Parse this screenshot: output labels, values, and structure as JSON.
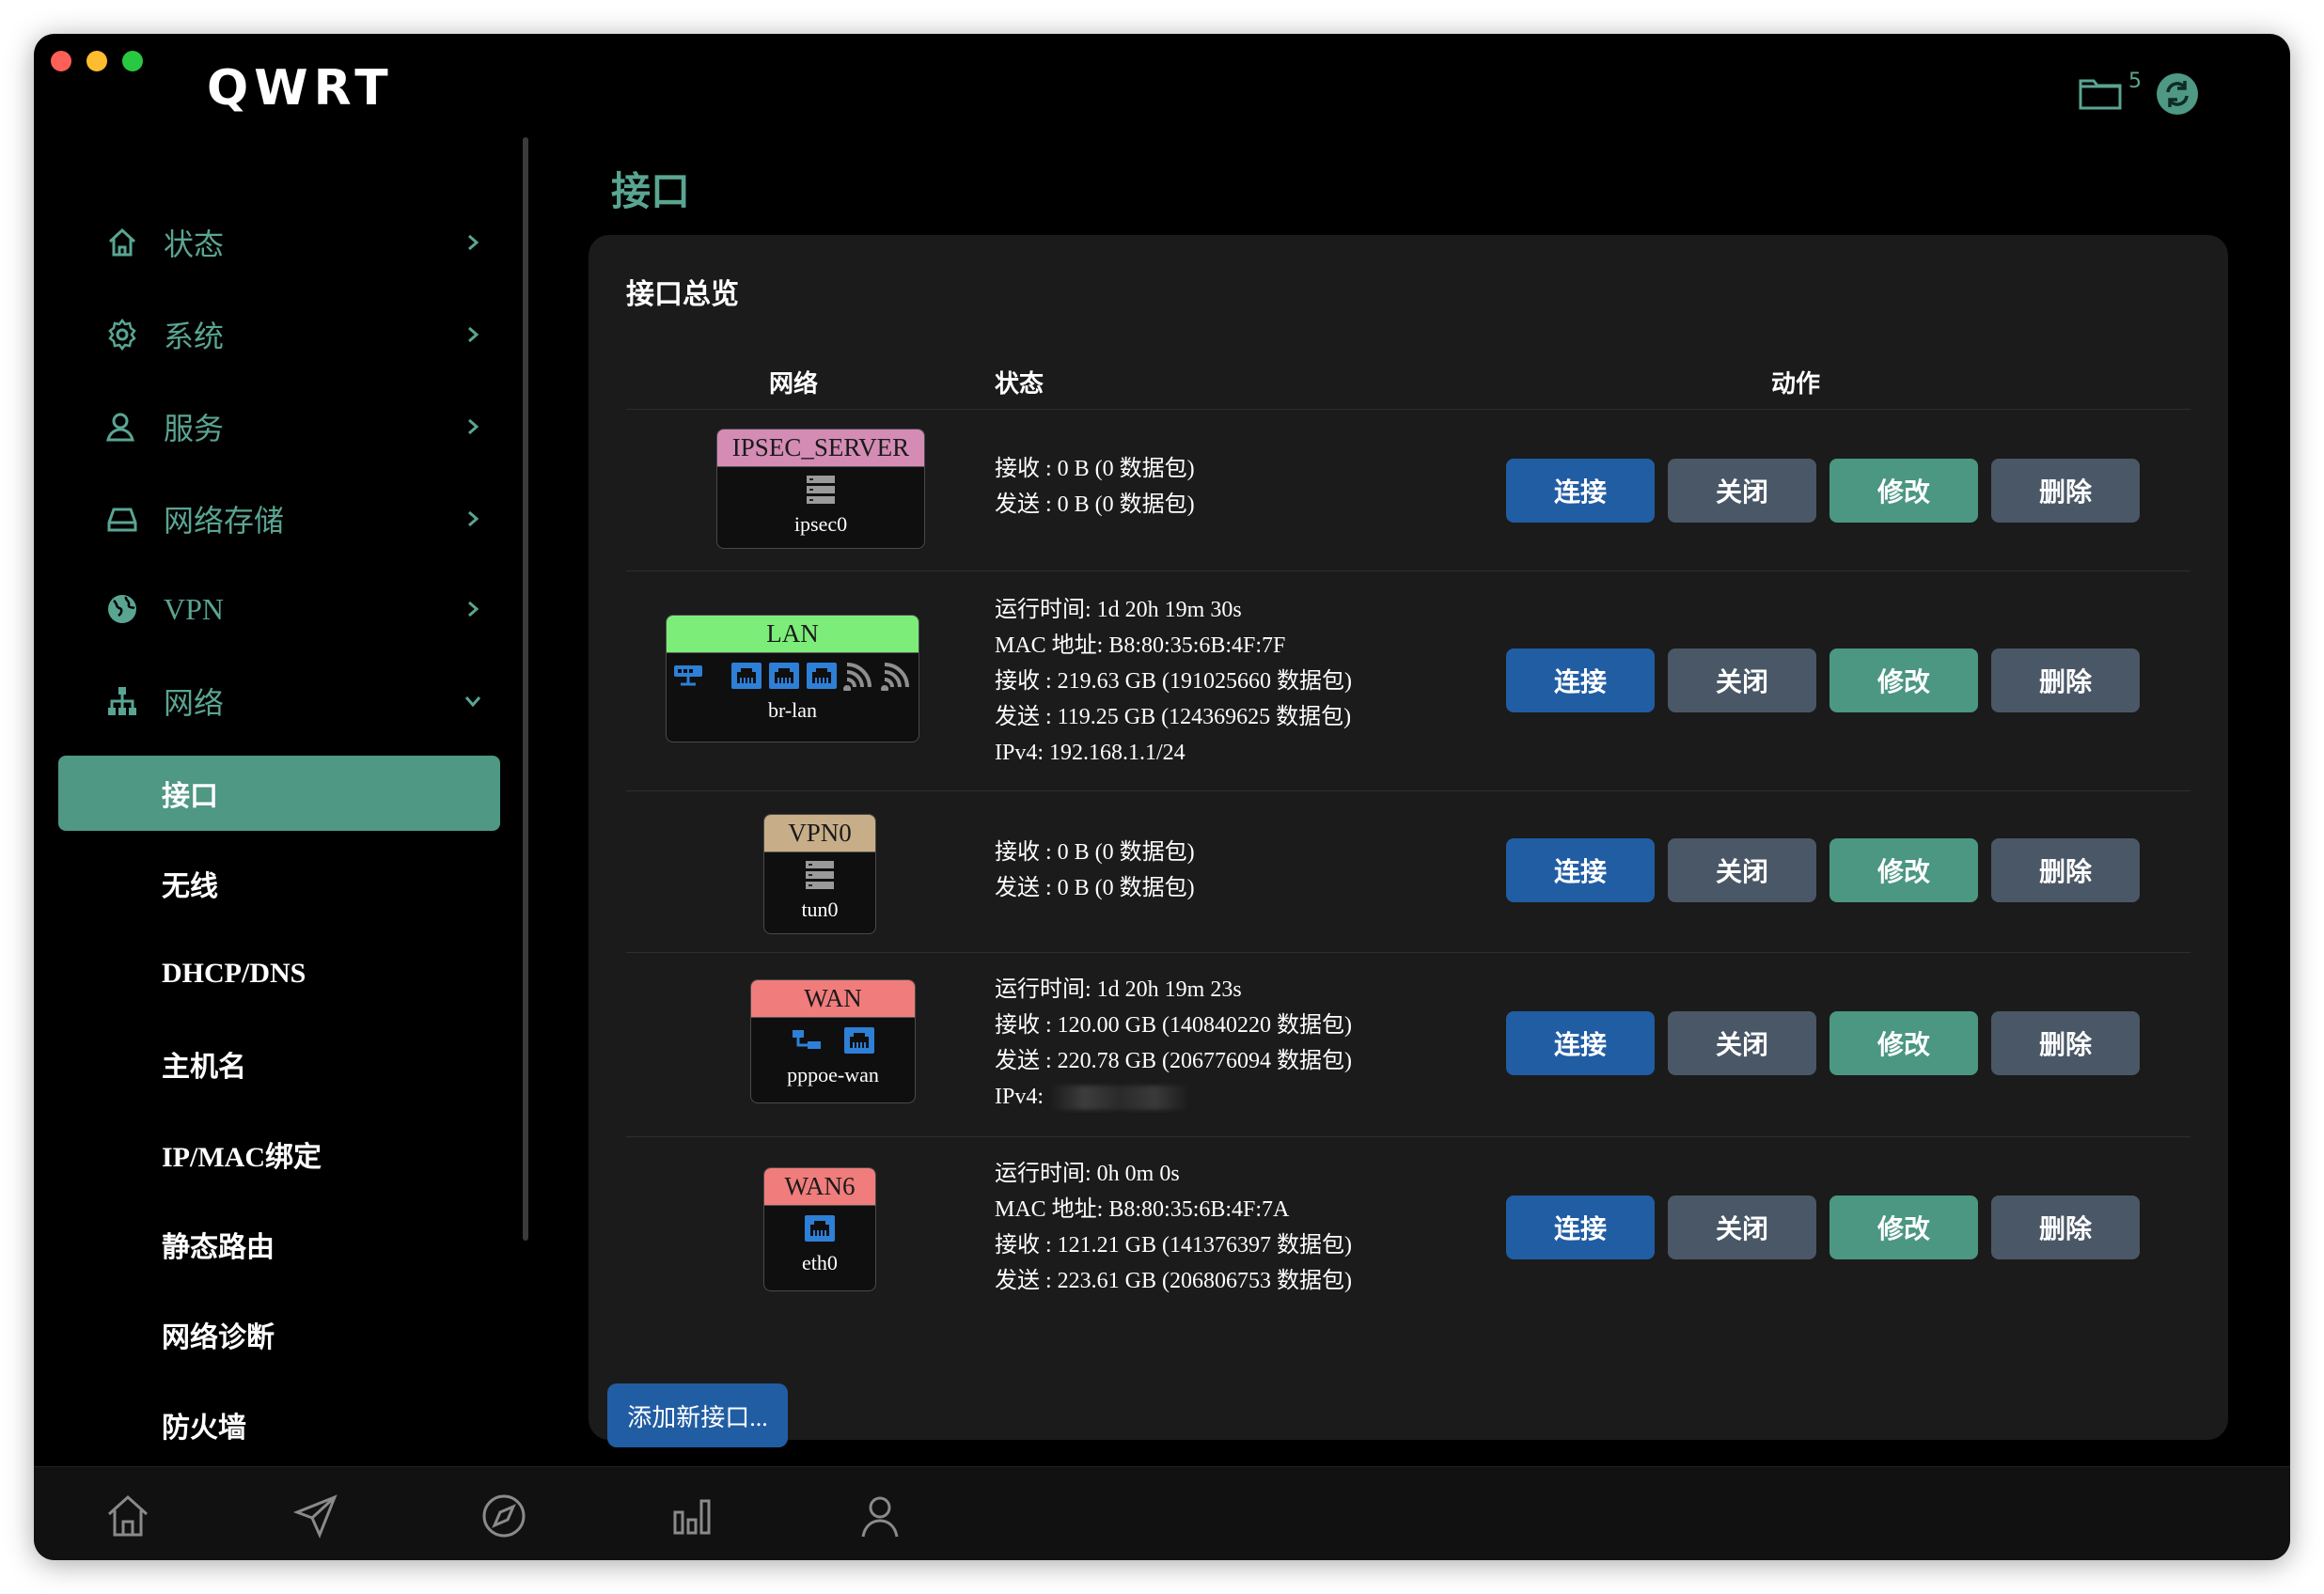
{
  "app": {
    "title": "QWRT",
    "notification_count": "5"
  },
  "sidebar": {
    "items": [
      {
        "label": "状态",
        "icon": "home-icon"
      },
      {
        "label": "系统",
        "icon": "gear-icon"
      },
      {
        "label": "服务",
        "icon": "user-icon"
      },
      {
        "label": "网络存储",
        "icon": "drive-icon"
      },
      {
        "label": "VPN",
        "icon": "globe-icon"
      },
      {
        "label": "网络",
        "icon": "network-icon"
      }
    ],
    "sub_items": [
      {
        "label": "接口",
        "active": true
      },
      {
        "label": "无线"
      },
      {
        "label": "DHCP/DNS"
      },
      {
        "label": "主机名"
      },
      {
        "label": "IP/MAC绑定"
      },
      {
        "label": "静态路由"
      },
      {
        "label": "网络诊断"
      },
      {
        "label": "防火墙"
      }
    ]
  },
  "main": {
    "title": "接口",
    "panel_title": "接口总览",
    "columns": {
      "network": "网络",
      "status": "状态",
      "actions": "动作"
    },
    "buttons": {
      "connect": "连接",
      "close": "关闭",
      "edit": "修改",
      "delete": "删除"
    },
    "add_button": "添加新接口...",
    "rows": [
      {
        "name": "IPSEC_SERVER",
        "device": "ipsec0",
        "color": "#d48cb5",
        "status": [
          "接收 : 0 B (0 数据包)",
          "发送 : 0 B (0 数据包)"
        ]
      },
      {
        "name": "LAN",
        "device": "br-lan",
        "color": "#7ded7a",
        "status": [
          "运行时间:  1d 20h 19m 30s",
          "MAC 地址:  B8:80:35:6B:4F:7F",
          "接收 : 219.63 GB (191025660 数据包)",
          "发送 : 119.25 GB (124369625 数据包)",
          "IPv4:  192.168.1.1/24"
        ]
      },
      {
        "name": "VPN0",
        "device": "tun0",
        "color": "#c7ae88",
        "status": [
          "接收 : 0 B (0 数据包)",
          "发送 : 0 B (0 数据包)"
        ]
      },
      {
        "name": "WAN",
        "device": "pppoe-wan",
        "color": "#f07c7c",
        "status": [
          "运行时间:  1d 20h 19m 23s",
          "接收 : 120.00 GB (140840220 数据包)",
          "发送 : 220.78 GB (206776094 数据包)",
          "IPv4:"
        ]
      },
      {
        "name": "WAN6",
        "device": "eth0",
        "color": "#f07c7c",
        "status": [
          "运行时间:  0h 0m 0s",
          "MAC 地址:  B8:80:35:6B:4F:7A",
          "接收 : 121.21 GB (141376397 数据包)",
          "发送 : 223.61 GB (206806753 数据包)"
        ]
      }
    ]
  },
  "colors": {
    "accent": "#5aa592",
    "active_bg": "#4f9883",
    "btn_blue": "#215da3",
    "btn_gray": "#4a5766",
    "btn_green": "#4b9782"
  }
}
